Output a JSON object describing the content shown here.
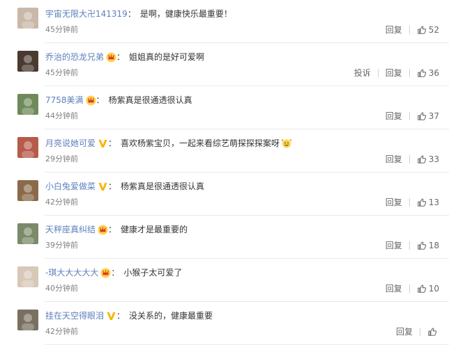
{
  "comments": [
    {
      "user": "宇宙无限大卍141319",
      "badge": "none",
      "text": "是啊，健康快乐最重要！",
      "emoji": "",
      "time": "45分钟前",
      "report": "",
      "reply": "回复",
      "likes": "52",
      "avatar_color": "#c9b8a8"
    },
    {
      "user": "乔治的恐龙兄弟",
      "badge": "crown",
      "text": "姐姐真的是好可爱啊",
      "emoji": "",
      "time": "45分钟前",
      "report": "投诉",
      "reply": "回复",
      "likes": "36",
      "avatar_color": "#4a3a30"
    },
    {
      "user": "7758美满",
      "badge": "crown",
      "text": "杨紫真是很通透很认真",
      "emoji": "",
      "time": "44分钟前",
      "report": "",
      "reply": "回复",
      "likes": "37",
      "avatar_color": "#6f8a5a"
    },
    {
      "user": "月亮说她可爱",
      "badge": "v",
      "text": "喜欢杨紫宝贝，一起来看综艺萌探探探案呀",
      "emoji": "cheer",
      "time": "29分钟前",
      "report": "",
      "reply": "回复",
      "likes": "33",
      "avatar_color": "#b65a4a"
    },
    {
      "user": "小白兔爱做菜",
      "badge": "v",
      "text": "杨紫真是很通透很认真",
      "emoji": "",
      "time": "42分钟前",
      "report": "",
      "reply": "回复",
      "likes": "13",
      "avatar_color": "#8a6a4a"
    },
    {
      "user": "天秤座真纠结",
      "badge": "crown",
      "text": "健康才是最重要的",
      "emoji": "",
      "time": "39分钟前",
      "report": "",
      "reply": "回复",
      "likes": "18",
      "avatar_color": "#7a8a6a"
    },
    {
      "user": "-琪大大大大大",
      "badge": "crown",
      "text": "小猴子太可爱了",
      "emoji": "",
      "time": "40分钟前",
      "report": "",
      "reply": "回复",
      "likes": "10",
      "avatar_color": "#d8c8b8"
    },
    {
      "user": "挂在天空得眼泪",
      "badge": "v",
      "text": "没关系的，健康最重要",
      "emoji": "",
      "time": "42分钟前",
      "report": "",
      "reply": "回复",
      "likes": "",
      "avatar_color": "#7a7060"
    }
  ],
  "colors": {
    "username": "#5b7fbd",
    "crown": "#f5a623",
    "v_badge": "#f5a623"
  }
}
